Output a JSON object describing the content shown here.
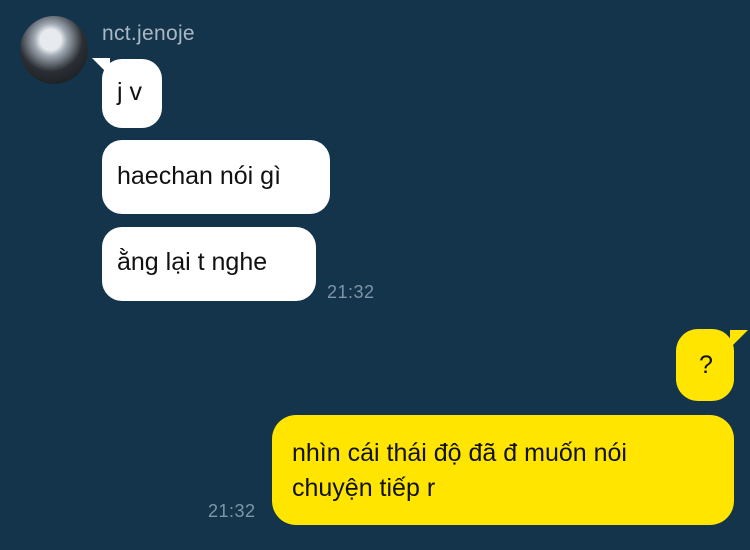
{
  "chat": {
    "sender": {
      "name": "nct.jenoje"
    },
    "messages": {
      "incoming": [
        {
          "text": "j v"
        },
        {
          "text": "haechan nói gì"
        },
        {
          "text": "ằng lại t nghe"
        }
      ],
      "incoming_time": "21:32",
      "outgoing_question": {
        "text": "?"
      },
      "outgoing_main": {
        "line1": "nhìn cái thái độ đã đ muốn nói",
        "line2": "chuyện tiếp r"
      },
      "outgoing_time": "21:32"
    }
  }
}
